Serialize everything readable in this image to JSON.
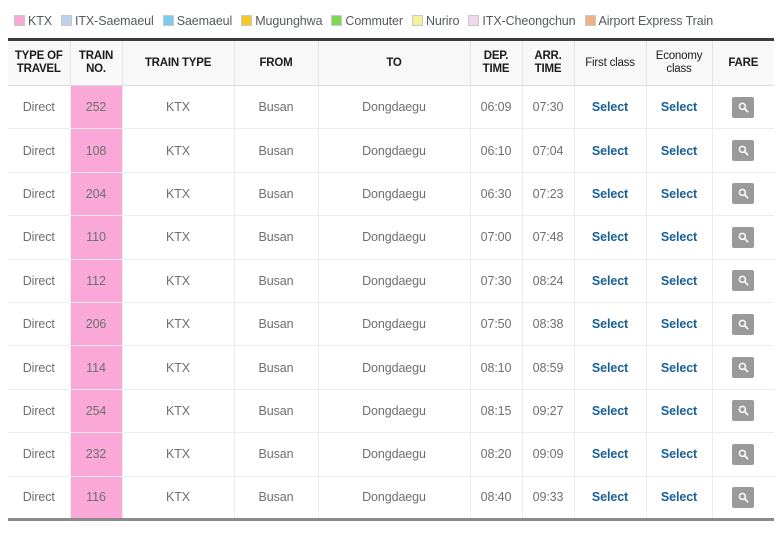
{
  "legend": {
    "items": [
      {
        "label": "KTX",
        "color": "#f9a8d8"
      },
      {
        "label": "ITX-Saemaeul",
        "color": "#bcd2f0"
      },
      {
        "label": "Saemaeul",
        "color": "#7ecbf0"
      },
      {
        "label": "Mugunghwa",
        "color": "#f5c92b"
      },
      {
        "label": "Commuter",
        "color": "#7ed957"
      },
      {
        "label": "Nuriro",
        "color": "#f5f09a"
      },
      {
        "label": "ITX-Cheongchun",
        "color": "#f3d7ea"
      },
      {
        "label": "Airport Express Train",
        "color": "#f0b184"
      }
    ]
  },
  "table": {
    "headers": [
      "TYPE OF TRAVEL",
      "TRAIN NO.",
      "TRAIN TYPE",
      "FROM",
      "TO",
      "DEP. TIME",
      "ARR. TIME",
      "First class",
      "Economy class",
      "FARE"
    ],
    "select_label": "Select",
    "fare_icon": "magnifier-icon",
    "rows": [
      {
        "type": "Direct",
        "no": "252",
        "train_type": "KTX",
        "from": "Busan",
        "to": "Dongdaegu",
        "dep": "06:09",
        "arr": "07:30",
        "first": "Select",
        "economy": "Select"
      },
      {
        "type": "Direct",
        "no": "108",
        "train_type": "KTX",
        "from": "Busan",
        "to": "Dongdaegu",
        "dep": "06:10",
        "arr": "07:04",
        "first": "Select",
        "economy": "Select"
      },
      {
        "type": "Direct",
        "no": "204",
        "train_type": "KTX",
        "from": "Busan",
        "to": "Dongdaegu",
        "dep": "06:30",
        "arr": "07:23",
        "first": "Select",
        "economy": "Select"
      },
      {
        "type": "Direct",
        "no": "110",
        "train_type": "KTX",
        "from": "Busan",
        "to": "Dongdaegu",
        "dep": "07:00",
        "arr": "07:48",
        "first": "Select",
        "economy": "Select"
      },
      {
        "type": "Direct",
        "no": "112",
        "train_type": "KTX",
        "from": "Busan",
        "to": "Dongdaegu",
        "dep": "07:30",
        "arr": "08:24",
        "first": "Select",
        "economy": "Select"
      },
      {
        "type": "Direct",
        "no": "206",
        "train_type": "KTX",
        "from": "Busan",
        "to": "Dongdaegu",
        "dep": "07:50",
        "arr": "08:38",
        "first": "Select",
        "economy": "Select"
      },
      {
        "type": "Direct",
        "no": "114",
        "train_type": "KTX",
        "from": "Busan",
        "to": "Dongdaegu",
        "dep": "08:10",
        "arr": "08:59",
        "first": "Select",
        "economy": "Select"
      },
      {
        "type": "Direct",
        "no": "254",
        "train_type": "KTX",
        "from": "Busan",
        "to": "Dongdaegu",
        "dep": "08:15",
        "arr": "09:27",
        "first": "Select",
        "economy": "Select"
      },
      {
        "type": "Direct",
        "no": "232",
        "train_type": "KTX",
        "from": "Busan",
        "to": "Dongdaegu",
        "dep": "08:20",
        "arr": "09:09",
        "first": "Select",
        "economy": "Select"
      },
      {
        "type": "Direct",
        "no": "116",
        "train_type": "KTX",
        "from": "Busan",
        "to": "Dongdaegu",
        "dep": "08:40",
        "arr": "09:33",
        "first": "Select",
        "economy": "Select"
      }
    ]
  },
  "colors": {
    "highlight_pink": "#f9a8d8",
    "link_blue": "#1a5f95",
    "fare_button_gray": "#9a9a9a"
  }
}
